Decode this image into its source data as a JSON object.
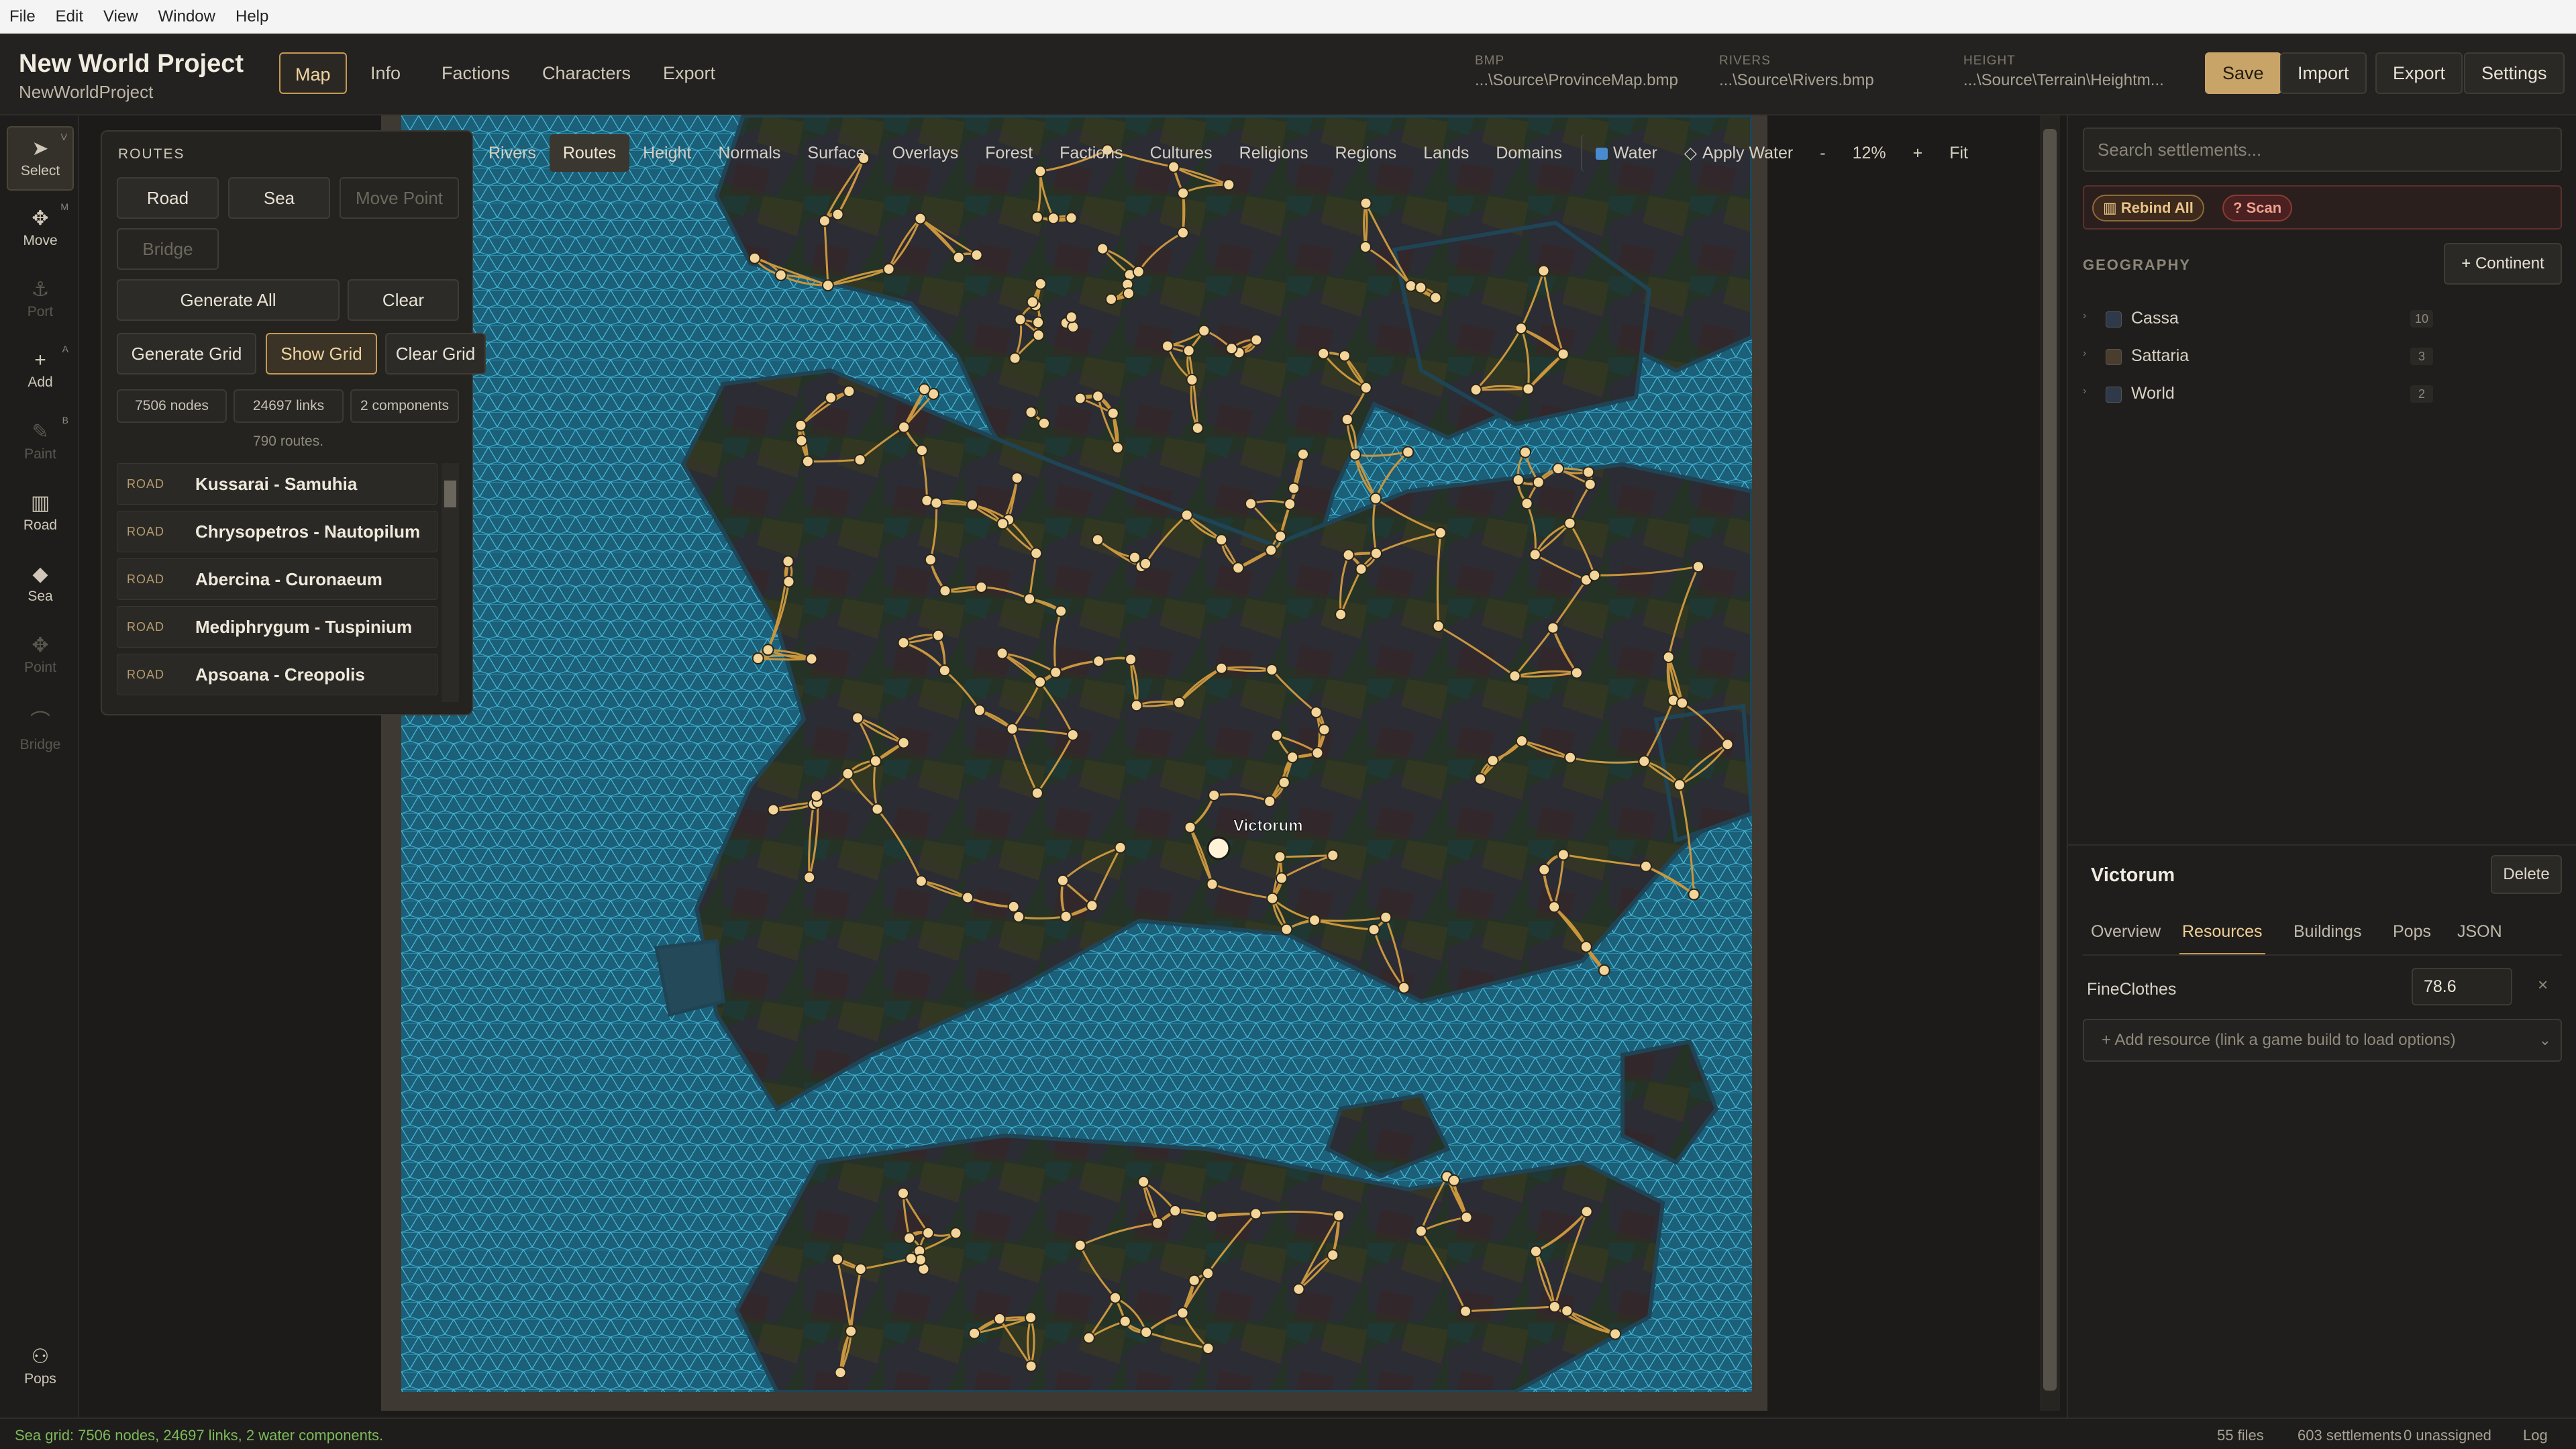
{
  "menubar": [
    "File",
    "Edit",
    "View",
    "Window",
    "Help"
  ],
  "app": {
    "title": "New World Project",
    "subtitle": "NewWorldProject"
  },
  "nav_tabs": [
    "Map",
    "Info",
    "Factions",
    "Characters",
    "Export"
  ],
  "file_info": [
    {
      "label": "BMP",
      "value": "...\\Source\\ProvinceMap.bmp"
    },
    {
      "label": "RIVERS",
      "value": "...\\Source\\Rivers.bmp"
    },
    {
      "label": "HEIGHT",
      "value": "...\\Source\\Terrain\\Heightm..."
    }
  ],
  "header_buttons": {
    "save": "Save",
    "import": "Import",
    "export": "Export",
    "settings": "Settings"
  },
  "tools": [
    {
      "label": "Select",
      "key": "V",
      "icon": "cursor-icon",
      "glyph": "➤"
    },
    {
      "label": "Move",
      "key": "M",
      "icon": "move-icon",
      "glyph": "✥"
    },
    {
      "label": "Port",
      "key": "",
      "icon": "anchor-icon",
      "glyph": "⚓"
    },
    {
      "label": "Add",
      "key": "A",
      "icon": "plus-icon",
      "glyph": "+"
    },
    {
      "label": "Paint",
      "key": "B",
      "icon": "brush-icon",
      "glyph": "✎"
    },
    {
      "label": "Road",
      "key": "",
      "icon": "map-icon",
      "glyph": "▥"
    },
    {
      "label": "Sea",
      "key": "",
      "icon": "water-drop-icon",
      "glyph": "◆"
    },
    {
      "label": "Point",
      "key": "",
      "icon": "point-icon",
      "glyph": "✥"
    },
    {
      "label": "Bridge",
      "key": "",
      "icon": "bridge-icon",
      "glyph": "⌒"
    }
  ],
  "pops_tool": {
    "label": "Pops",
    "icon": "people-icon",
    "glyph": "⚇"
  },
  "map_tabs": [
    "Rivers",
    "Routes",
    "Height",
    "Normals",
    "Surface",
    "Overlays",
    "Forest",
    "Factions",
    "Cultures",
    "Religions",
    "Regions",
    "Lands",
    "Domains"
  ],
  "map_controls": {
    "water": "Water",
    "apply_water": "Apply Water",
    "zoom_out": "-",
    "zoom": "12%",
    "zoom_in": "+",
    "fit": "Fit"
  },
  "routes_panel": {
    "header": "ROUTES",
    "buttons": {
      "road": "Road",
      "sea": "Sea",
      "move_point": "Move Point",
      "bridge": "Bridge",
      "generate_all": "Generate All",
      "clear": "Clear",
      "generate_grid": "Generate Grid",
      "show_grid": "Show Grid",
      "clear_grid": "Clear Grid"
    },
    "stats": {
      "nodes": "7506 nodes",
      "links": "24697 links",
      "components": "2 components"
    },
    "route_count": "790 routes.",
    "items": [
      {
        "kind": "ROAD",
        "name": "Kussarai - Samuhia"
      },
      {
        "kind": "ROAD",
        "name": "Chrysopetros - Nautopilum"
      },
      {
        "kind": "ROAD",
        "name": "Abercina - Curonaeum"
      },
      {
        "kind": "ROAD",
        "name": "Mediphrygum - Tuspinium"
      },
      {
        "kind": "ROAD",
        "name": "Apsoana - Creopolis"
      }
    ]
  },
  "map": {
    "selected_label": "Victorum"
  },
  "right_panel": {
    "search_placeholder": "Search settlements...",
    "rebind_all": "Rebind All",
    "scan": "Scan",
    "geography_header": "GEOGRAPHY",
    "add_continent": "+ Continent",
    "geography": [
      {
        "name": "Cassa",
        "count": "10",
        "color": "#2e3a4a"
      },
      {
        "name": "Sattaria",
        "count": "3",
        "color": "#4a3d2e"
      },
      {
        "name": "World",
        "count": "2",
        "color": "#2e3a4a"
      }
    ],
    "detail": {
      "title": "Victorum",
      "delete": "Delete",
      "tabs": [
        "Overview",
        "Resources",
        "Buildings",
        "Pops",
        "JSON"
      ],
      "active_tab": "Resources",
      "resource": {
        "name": "FineClothes",
        "value": "78.6"
      },
      "add_resource": "+ Add resource (link a game build to load options)"
    }
  },
  "status": {
    "left": "Sea grid: 7506 nodes, 24697 links, 2 water components.",
    "files": "55 files",
    "settlements": "603 settlements",
    "unassigned": "0 unassigned",
    "log": "Log"
  },
  "colors": {
    "accent": "#c79a52",
    "save": "#c9a468",
    "sea": "#1b5a73",
    "mesh": "#3fb6d8",
    "road": "#c9963e",
    "settlement": "#f3d59a"
  }
}
